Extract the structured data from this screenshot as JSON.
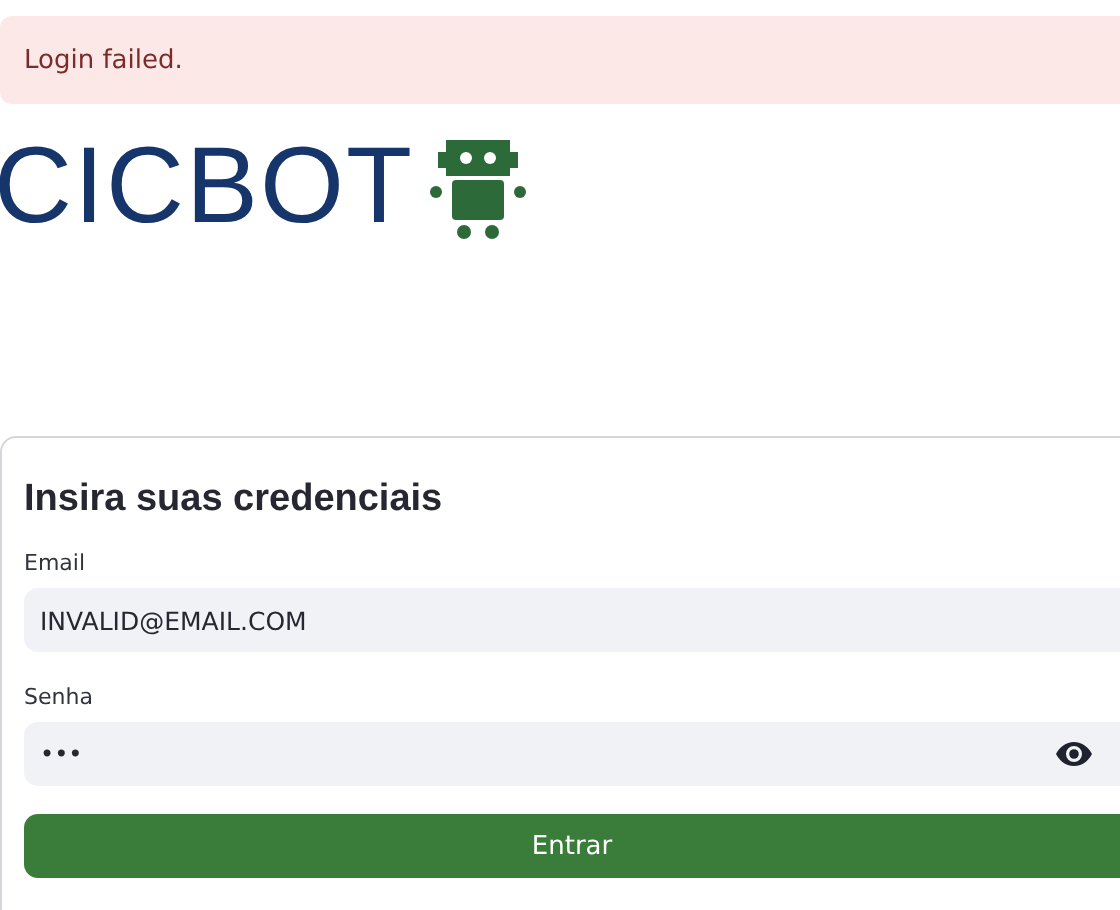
{
  "alert": {
    "message": "Login failed."
  },
  "logo": {
    "text": "CICBOT"
  },
  "form": {
    "title": "Insira suas credenciais",
    "fields": [
      {
        "label": "Email",
        "value": "INVALID@EMAIL.COM",
        "kind": "text"
      },
      {
        "label": "Senha",
        "value": "•••",
        "kind": "password"
      }
    ],
    "submit": "Entrar"
  }
}
